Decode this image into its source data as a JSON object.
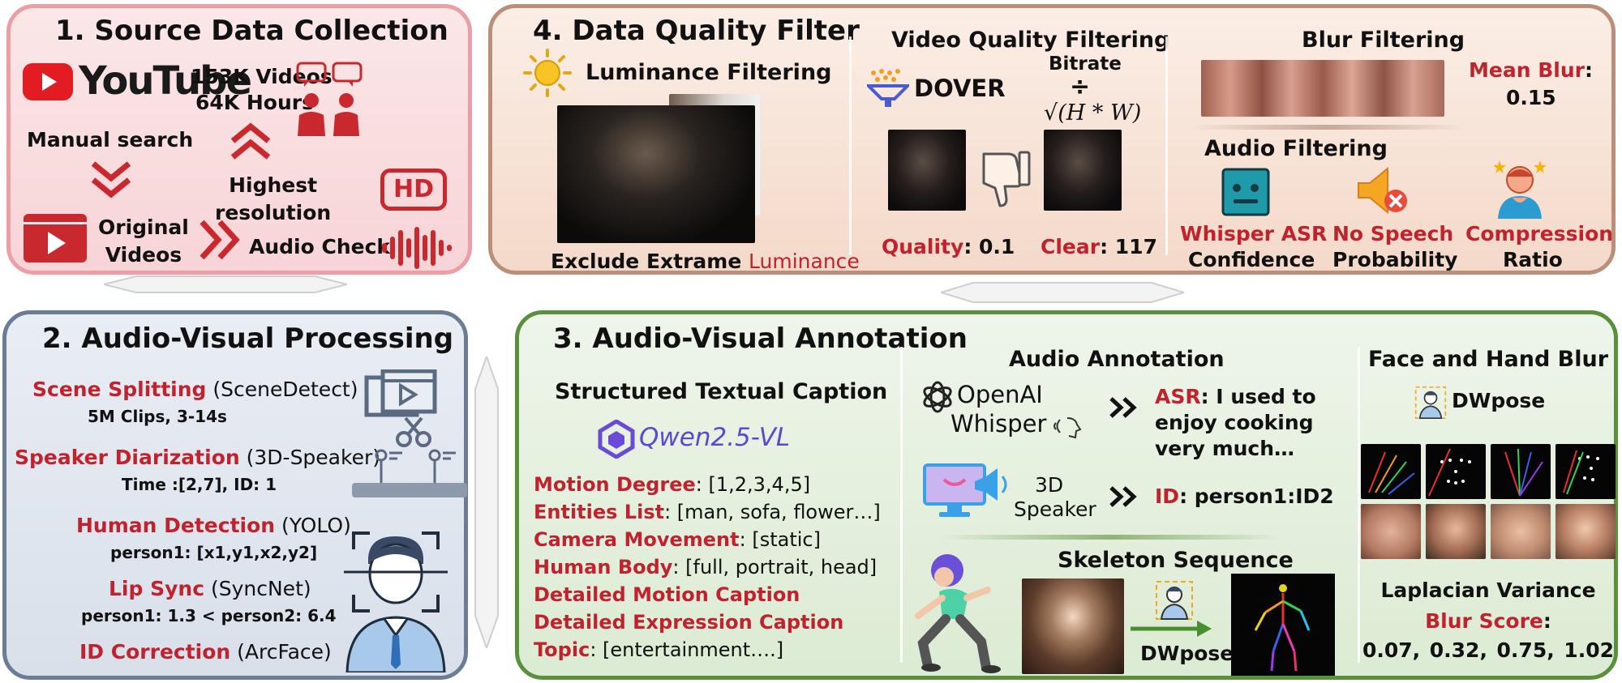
{
  "colors": {
    "accent_red": "#c0232e",
    "panel1_border": "#ec9ea4",
    "panel2_border": "#6b7d96",
    "panel3_border": "#5a8f3e",
    "panel4_border": "#b98f7a"
  },
  "panel1": {
    "title": "1. Source Data Collection",
    "youtube": "YouTube",
    "videos_count": "153K Videos",
    "hours_count": "64K Hours",
    "manual_search": "Manual search",
    "original_videos": "Original\nVideos",
    "highest_resolution": "Highest\nresolution",
    "hd_badge": "HD",
    "audio_check": "Audio Check"
  },
  "panel4": {
    "title": "4. Data Quality Filter",
    "luminance_filtering": "Luminance Filtering",
    "exclude_prefix": "Exclude Extrame ",
    "exclude_highlight": "Luminance",
    "video_quality_filtering": "Video Quality Filtering",
    "dover": "DOVER",
    "bitrate": "Bitrate",
    "divide": "÷",
    "formula": "√(H * W)",
    "quality_label": "Quality",
    "quality_value": ": 0.1",
    "clear_label": "Clear",
    "clear_value": ": 117",
    "blur_filtering": "Blur Filtering",
    "mean_blur_label": "Mean Blur",
    "mean_blur_colon": ":",
    "mean_blur_value": "0.15",
    "audio_filtering": "Audio Filtering",
    "whisper_asr": "Whisper ASR",
    "confidence": "Confidence",
    "no_speech": "No Speech",
    "probability": "Probability",
    "compression": "Compression",
    "ratio": "Ratio"
  },
  "panel2": {
    "title": "2. Audio-Visual Processing",
    "scene_label": "Scene Splitting",
    "scene_tool": " (SceneDetect)",
    "scene_detail": "5M Clips, 3-14s",
    "speaker_label": "Speaker Diarization",
    "speaker_tool": " (3D-Speaker)",
    "speaker_detail": "Time :[2,7], ID: 1",
    "human_label": "Human Detection",
    "human_tool": " (YOLO)",
    "human_detail": "person1: [x1,y1,x2,y2]",
    "lip_label": "Lip Sync",
    "lip_tool": " (SyncNet)",
    "lip_detail": "person1: 1.3  < person2: 6.4",
    "id_label": "ID Correction",
    "id_tool": " (ArcFace)"
  },
  "panel3": {
    "title": "3. Audio-Visual Annotation",
    "caption_heading": "Structured Textual Caption",
    "qwen": "Qwen2.5-VL",
    "fields": [
      {
        "label": "Motion Degree",
        "value": ": [1,2,3,4,5]"
      },
      {
        "label": "Entities List",
        "value": ": [man, sofa, flower…]"
      },
      {
        "label": "Camera Movement",
        "value": ": [static]"
      },
      {
        "label": "Human Body",
        "value": ": [full, portrait, head]"
      },
      {
        "label": "Detailed Motion Caption",
        "value": ""
      },
      {
        "label": "Detailed Expression Caption",
        "value": ""
      },
      {
        "label": "Topic",
        "value": ": [entertainment….]"
      }
    ],
    "audio_annotation": "Audio Annotation",
    "openai": "OpenAI",
    "whisper": "Whisper",
    "asr_label": "ASR",
    "asr_line1": ": I used to",
    "asr_line2": "enjoy cooking",
    "asr_line3": "very much…",
    "speaker_3d": "3D",
    "speaker_word": "Speaker",
    "id_label": "ID",
    "id_value": ": person1:ID2",
    "skeleton_sequence": "Skeleton Sequence",
    "dwpose_arrow": "DWpose",
    "face_hand_blur": "Face and Hand Blur",
    "dwpose": "DWpose",
    "laplacian": "Laplacian Variance",
    "blur_score_label": "Blur Score",
    "blur_score_colon": ":",
    "blur_scores": [
      "0.07,",
      "0.32,",
      "0.75,",
      "1.02"
    ]
  }
}
